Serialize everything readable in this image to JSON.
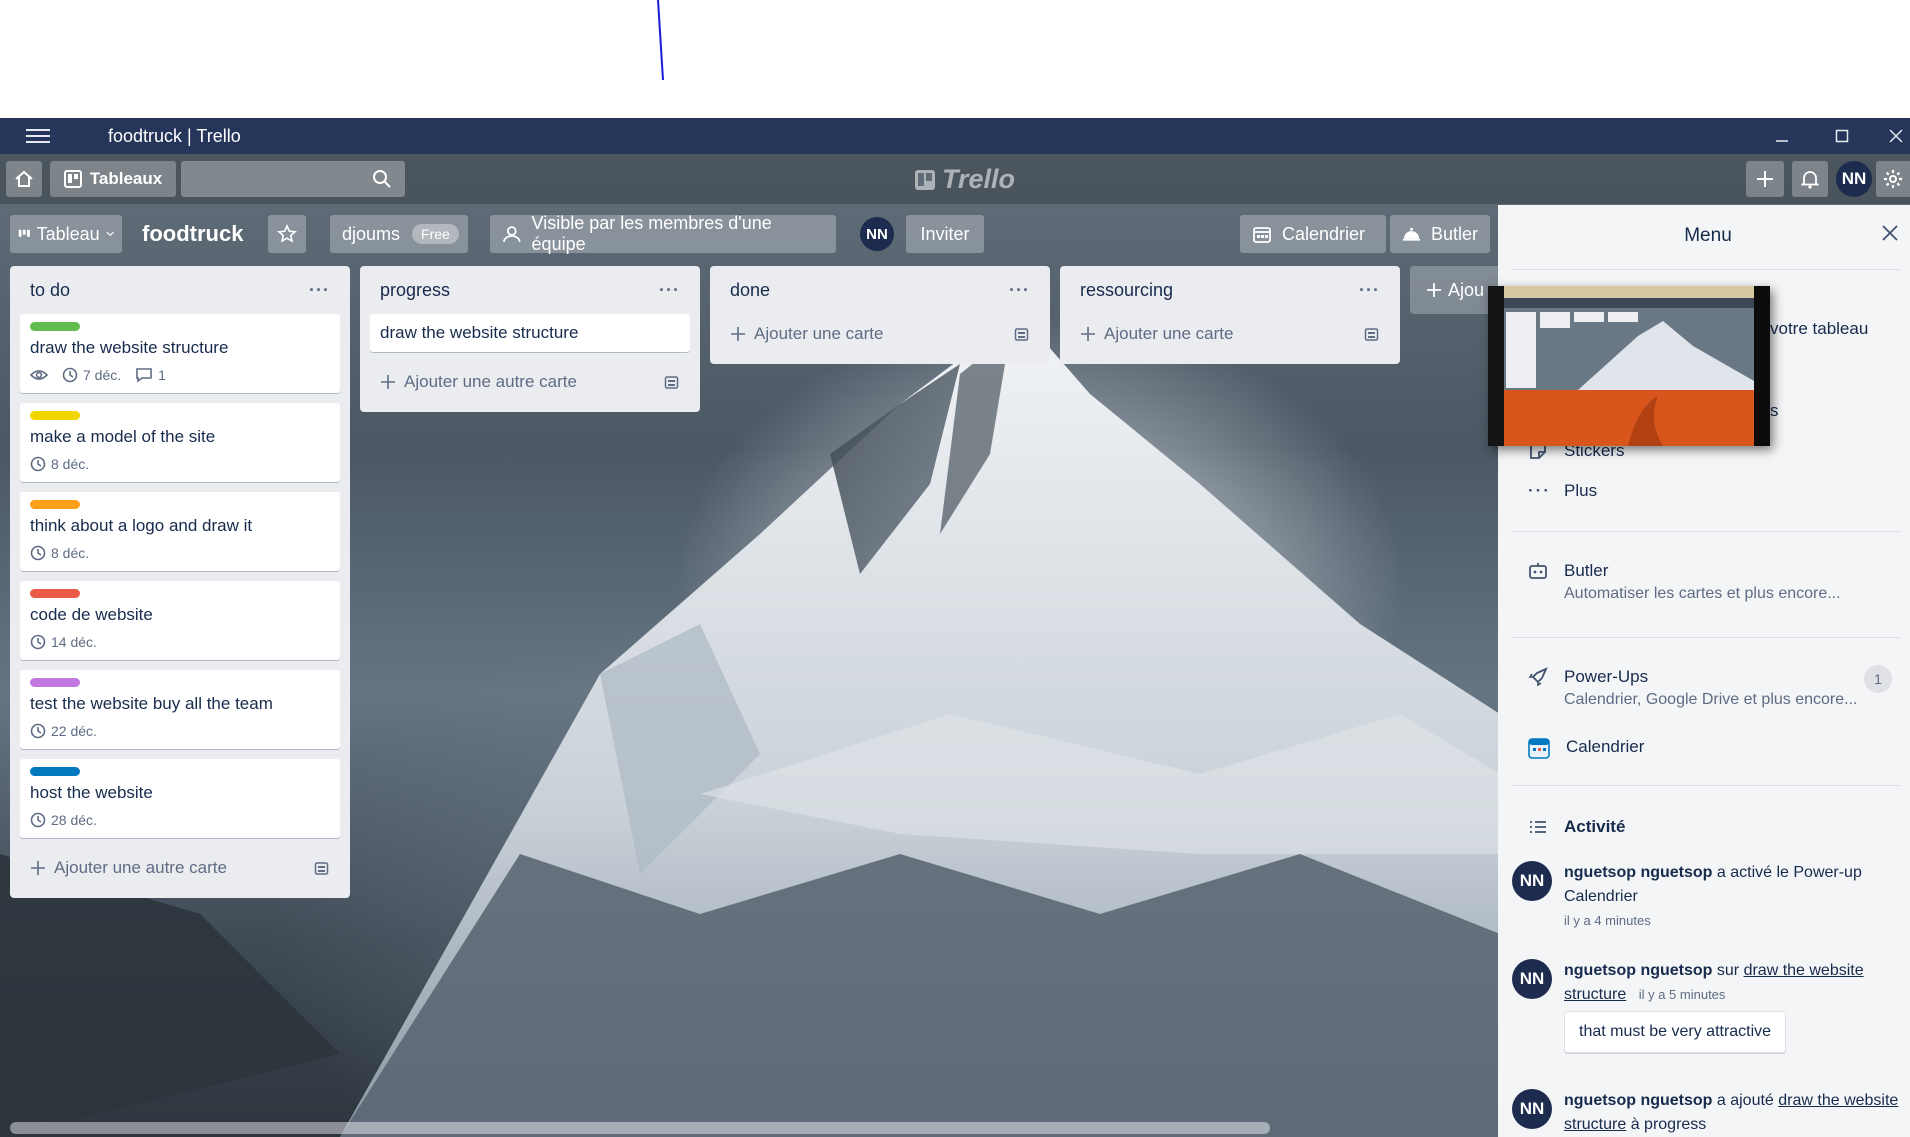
{
  "window": {
    "title": "foodtruck | Trello",
    "minimize": "—",
    "maximize": "☐",
    "close": "✕"
  },
  "header": {
    "boards_label": "Tableaux",
    "search_placeholder": "",
    "logo_text": "Trello",
    "avatar": "NN"
  },
  "board": {
    "view_label": "Tableau",
    "name": "foodtruck",
    "team": "djoums",
    "plan": "Free",
    "visibility": "Visible par les membres d'une équipe",
    "member_avatar": "NN",
    "invite": "Inviter",
    "calendar": "Calendrier",
    "butler": "Butler",
    "add_list": "Ajou"
  },
  "lists": [
    {
      "title": "to do",
      "add": "Ajouter une autre carte",
      "cards": [
        {
          "label_color": "#61bd4f",
          "title": "draw the website structure",
          "due": "7 déc.",
          "comments": "1",
          "watch": true
        },
        {
          "label_color": "#f2d600",
          "title": "make a model of the site",
          "due": "8 déc."
        },
        {
          "label_color": "#ff9f1a",
          "title": "think about a logo and draw it",
          "due": "8 déc."
        },
        {
          "label_color": "#eb5a46",
          "title": "code de website",
          "due": "14 déc."
        },
        {
          "label_color": "#c377e0",
          "title": "test the website buy all the team",
          "due": "22 déc."
        },
        {
          "label_color": "#0079bf",
          "title": "host the website",
          "due": "28 déc."
        }
      ]
    },
    {
      "title": "progress",
      "add": "Ajouter une autre carte",
      "cards": [
        {
          "title": "draw the website structure"
        }
      ]
    },
    {
      "title": "done",
      "add": "Ajouter une carte",
      "cards": []
    },
    {
      "title": "ressourcing",
      "add": "Ajouter une carte",
      "cards": []
    }
  ],
  "menu": {
    "title": "Menu",
    "partial_text_1": "votre tableau",
    "partial_text_2": "s",
    "stickers": "Stickers",
    "more": "Plus",
    "butler_title": "Butler",
    "butler_sub": "Automatiser les cartes et plus encore...",
    "powerups_title": "Power-Ups",
    "powerups_sub": "Calendrier, Google Drive et plus encore...",
    "powerups_count": "1",
    "calendar": "Calendrier",
    "activity_title": "Activité",
    "activities": [
      {
        "avatar": "NN",
        "user": "nguetsop nguetsop",
        "text": " a activé le Power-up Calendrier",
        "when": "il y a 4 minutes"
      },
      {
        "avatar": "NN",
        "user": "nguetsop nguetsop",
        "text": " sur ",
        "link": "draw the website structure",
        "when": "il y a 5 minutes",
        "comment": "that must be very attractive"
      },
      {
        "avatar": "NN",
        "user": "nguetsop nguetsop",
        "text": " a ajouté ",
        "link": "draw the website structure",
        "text2": " à progress"
      }
    ]
  }
}
